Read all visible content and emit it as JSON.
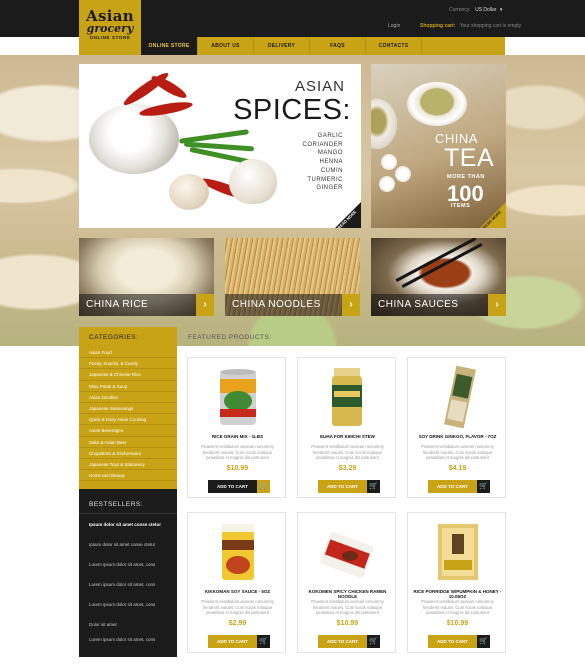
{
  "brand": {
    "line1": "Asian",
    "line2": "grocery",
    "line3": "ONLINE STORE"
  },
  "topbar": {
    "currency_label": "Currency:",
    "currency_value": "US Dollar",
    "login": "Login",
    "cart_label": "Shopping cart:",
    "cart_text": "Your shopping cart is empty"
  },
  "nav": [
    {
      "label": "ONLINE STORE",
      "active": true
    },
    {
      "label": "ABOUT US"
    },
    {
      "label": "DELIVERY"
    },
    {
      "label": "FAQS"
    },
    {
      "label": "CONTACTS"
    }
  ],
  "banners": {
    "spices": {
      "title1": "ASIAN",
      "title2": "SPICES:",
      "items": [
        "GARLIC",
        "CORIANDER",
        "MANGO",
        "HENNA",
        "CUMIN",
        "TURMERIC",
        "GINGER"
      ],
      "badge": "READ MORE"
    },
    "tea": {
      "title1": "CHINA",
      "title2": "TEA",
      "more": "MORE THAN",
      "count": "100",
      "items": "ITEMS",
      "badge": "READ MORE"
    }
  },
  "categories_tiles": [
    {
      "label": "CHINA RICE"
    },
    {
      "label": "CHINA NOODLES"
    },
    {
      "label": "CHINA SAUCES"
    }
  ],
  "sidebar": {
    "categories_title": "CATEGORIES:",
    "categories": [
      "Asian Food",
      "Pocky, Snacks, & Candy",
      "Japanese & Chinese Rice",
      "Miso Paste & Soup",
      "Asian Noodles",
      "Japanese Seasonings",
      "Quick & Easy Asian Cooking",
      "Asian Beverages",
      "Sake & Asian Beer",
      "Chopsticks & Kitchenware",
      "Japanese Toys & Stationery",
      "Home and Beauty"
    ],
    "bestsellers_title": "BESTSELLERS:",
    "bestsellers": [
      "Ipsum dolor sit amet conse ctetur",
      "Ipsum dolor sit amet conse ctetur",
      "Lorem ipsum dolor sit amet, cons",
      "Lorem ipsum dolor sit amet, cons",
      "Lorem ipsum dolor sit amet, cons",
      "Dolor sit amet",
      "Lorem ipsum dolor sit amet, cons"
    ]
  },
  "featured": {
    "title": "FEATURED PRODUCTS:",
    "products": [
      {
        "name": "RICE GRAIN MIX - 1LBS",
        "desc": "Praesent vestibulum aenean nonummy hendrerit mauris. Cum sociis natoque penatibus et magnis dis parturient",
        "price": "$10.99",
        "add": "ADD TO CART"
      },
      {
        "name": "EUHA FOR KIMCHI STEW",
        "desc": "Praesent vestibulum aenean nonummy hendrerit mauris. Cum sociis natoque penatibus et magnis dis parturient",
        "price": "$3.29",
        "add": "ADD TO CART"
      },
      {
        "name": "SOY DRINK GINKGO, FLAVOR - 7OZ",
        "desc": "Praesent vestibulum aenean nonummy hendrerit mauris. Cum sociis natoque penatibus et magnis dis parturient",
        "price": "$4.19",
        "add": "ADD TO CART"
      },
      {
        "name": "KIKKOMAN SOY SAUCE - 5OZ",
        "desc": "Praesent vestibulum aenean nonummy hendrerit mauris. Cum sociis natoque penatibus et magnis dis parturient",
        "price": "$2.99",
        "add": "ADD TO CART"
      },
      {
        "name": "KOKOMEN SPICY CHICKEN RAMEN NOODLE",
        "desc": "Praesent vestibulum aenean nonummy hendrerit mauris. Cum sociis natoque penatibus et magnis dis parturient",
        "price": "$10.99",
        "add": "ADD TO CART"
      },
      {
        "name": "RICE PORRIDGE W/PUMPKIN & HONEY - 10.05OZ",
        "desc": "Praesent vestibulum aenean nonummy hendrerit mauris. Cum sociis natoque penatibus et magnis dis parturient",
        "price": "$10.99",
        "add": "ADD TO CART"
      }
    ]
  },
  "colors": {
    "accent": "#c9a316",
    "dark": "#1b1b1b"
  }
}
